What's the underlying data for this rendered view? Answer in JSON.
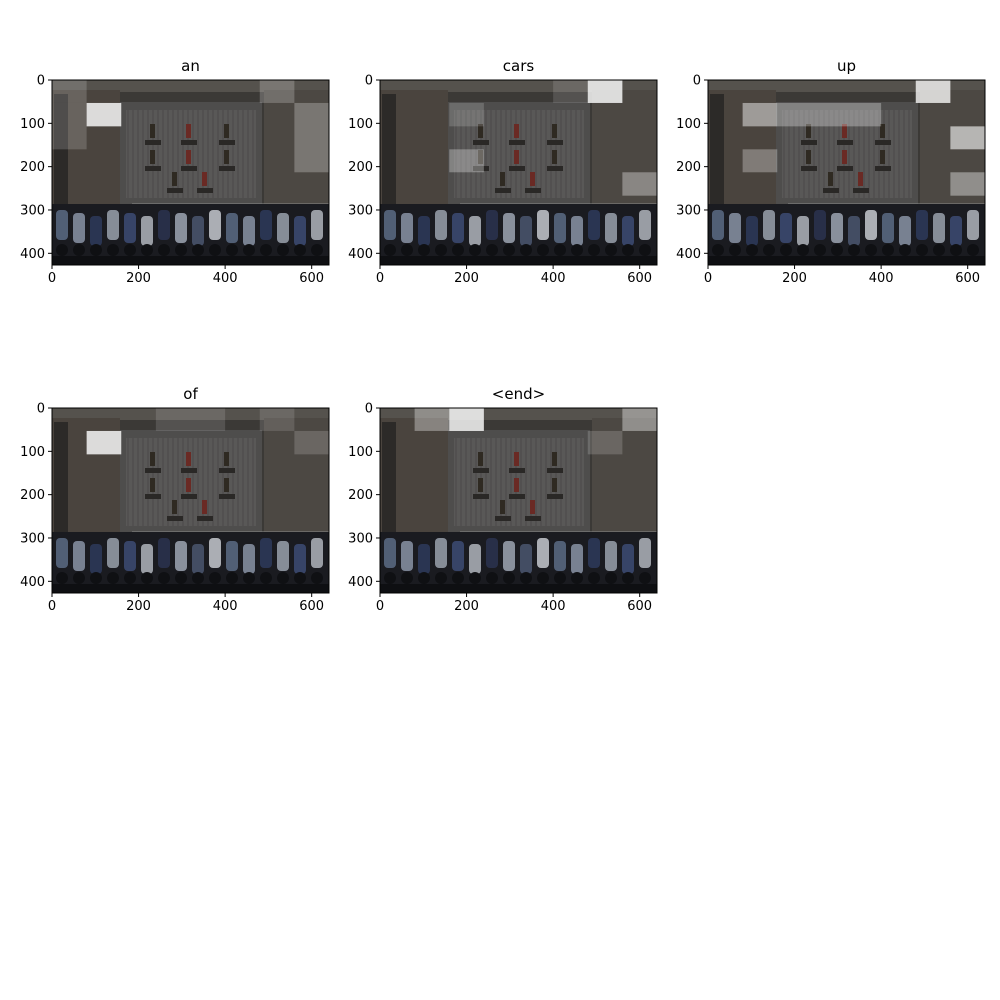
{
  "figure": {
    "background": "#ffffff",
    "axis_color": "#000000",
    "heat_color": "#ffffff"
  },
  "chart_data": [
    {
      "type": "heatmap",
      "title": "an",
      "xlim": [
        0,
        640
      ],
      "ylim": [
        427,
        0
      ],
      "xticks": [
        0,
        200,
        400,
        600
      ],
      "yticks": [
        0,
        100,
        200,
        300,
        400
      ],
      "attention_cells": [
        {
          "x": [
            80,
            160
          ],
          "y": [
            53,
            107
          ],
          "weight": 0.95
        },
        {
          "x": [
            0,
            80
          ],
          "y": [
            0,
            53
          ],
          "weight": 0.2
        },
        {
          "x": [
            480,
            560
          ],
          "y": [
            0,
            53
          ],
          "weight": 0.25
        },
        {
          "x": [
            560,
            640
          ],
          "y": [
            53,
            213
          ],
          "weight": 0.3
        },
        {
          "x": [
            0,
            80
          ],
          "y": [
            53,
            160
          ],
          "weight": 0.2
        }
      ]
    },
    {
      "type": "heatmap",
      "title": "cars",
      "xlim": [
        0,
        640
      ],
      "ylim": [
        427,
        0
      ],
      "xticks": [
        0,
        200,
        400,
        600
      ],
      "yticks": [
        0,
        100,
        200,
        300,
        400
      ],
      "attention_cells": [
        {
          "x": [
            480,
            560
          ],
          "y": [
            0,
            53
          ],
          "weight": 0.95
        },
        {
          "x": [
            560,
            640
          ],
          "y": [
            213,
            267
          ],
          "weight": 0.4
        },
        {
          "x": [
            160,
            240
          ],
          "y": [
            160,
            213
          ],
          "weight": 0.35
        },
        {
          "x": [
            160,
            240
          ],
          "y": [
            53,
            107
          ],
          "weight": 0.2
        },
        {
          "x": [
            400,
            480
          ],
          "y": [
            0,
            53
          ],
          "weight": 0.15
        }
      ]
    },
    {
      "type": "heatmap",
      "title": "up",
      "xlim": [
        0,
        640
      ],
      "ylim": [
        427,
        0
      ],
      "xticks": [
        0,
        200,
        400,
        600
      ],
      "yticks": [
        0,
        100,
        200,
        300,
        400
      ],
      "attention_cells": [
        {
          "x": [
            480,
            560
          ],
          "y": [
            0,
            53
          ],
          "weight": 0.9
        },
        {
          "x": [
            80,
            160
          ],
          "y": [
            53,
            107
          ],
          "weight": 0.55
        },
        {
          "x": [
            160,
            400
          ],
          "y": [
            53,
            107
          ],
          "weight": 0.35
        },
        {
          "x": [
            560,
            640
          ],
          "y": [
            107,
            160
          ],
          "weight": 0.7
        },
        {
          "x": [
            560,
            640
          ],
          "y": [
            213,
            267
          ],
          "weight": 0.45
        },
        {
          "x": [
            80,
            160
          ],
          "y": [
            160,
            213
          ],
          "weight": 0.35
        }
      ]
    },
    {
      "type": "heatmap",
      "title": "of",
      "xlim": [
        0,
        640
      ],
      "ylim": [
        427,
        0
      ],
      "xticks": [
        0,
        200,
        400,
        600
      ],
      "yticks": [
        0,
        100,
        200,
        300,
        400
      ],
      "attention_cells": [
        {
          "x": [
            80,
            160
          ],
          "y": [
            53,
            107
          ],
          "weight": 0.95
        },
        {
          "x": [
            560,
            640
          ],
          "y": [
            53,
            107
          ],
          "weight": 0.2
        },
        {
          "x": [
            480,
            560
          ],
          "y": [
            0,
            53
          ],
          "weight": 0.15
        },
        {
          "x": [
            240,
            400
          ],
          "y": [
            0,
            53
          ],
          "weight": 0.15
        }
      ]
    },
    {
      "type": "heatmap",
      "title": "<end>",
      "xlim": [
        0,
        640
      ],
      "ylim": [
        427,
        0
      ],
      "xticks": [
        0,
        200,
        400,
        600
      ],
      "yticks": [
        0,
        100,
        200,
        300,
        400
      ],
      "attention_cells": [
        {
          "x": [
            160,
            240
          ],
          "y": [
            0,
            53
          ],
          "weight": 0.95
        },
        {
          "x": [
            80,
            160
          ],
          "y": [
            0,
            53
          ],
          "weight": 0.4
        },
        {
          "x": [
            560,
            640
          ],
          "y": [
            0,
            53
          ],
          "weight": 0.45
        },
        {
          "x": [
            480,
            560
          ],
          "y": [
            53,
            107
          ],
          "weight": 0.2
        }
      ]
    }
  ]
}
